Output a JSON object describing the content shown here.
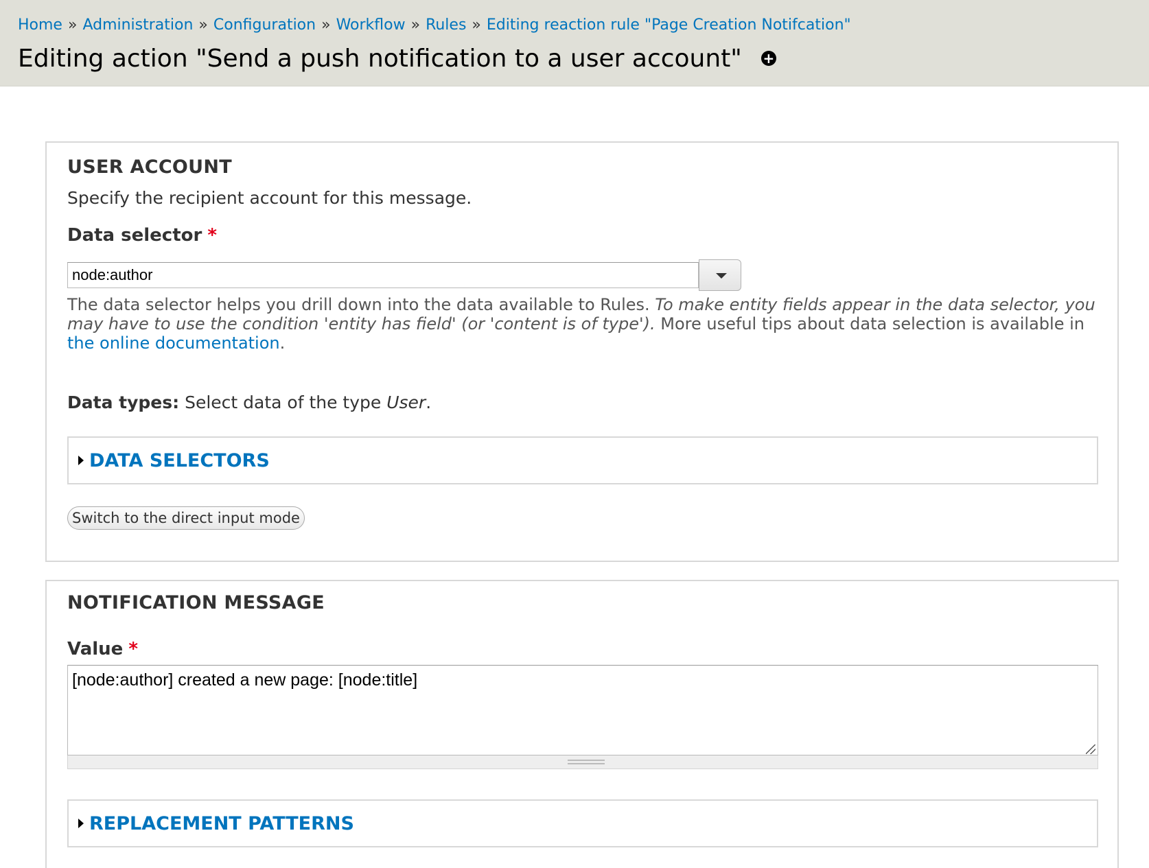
{
  "breadcrumb": [
    {
      "label": "Home"
    },
    {
      "label": "Administration"
    },
    {
      "label": "Configuration"
    },
    {
      "label": "Workflow"
    },
    {
      "label": "Rules"
    },
    {
      "label": "Editing reaction rule \"Page Creation Notifcation\""
    }
  ],
  "breadcrumb_separator": "»",
  "page_title": "Editing action \"Send a push notification to a user account\"",
  "shortcut_icon_glyph": "+",
  "user_account": {
    "legend": "User account",
    "description": "Specify the recipient account for this message.",
    "data_selector": {
      "label": "Data selector",
      "required_mark": "*",
      "value": "node:author"
    },
    "help": {
      "part1": "The data selector helps you drill down into the data available to Rules. ",
      "part2_italic": "To make entity fields appear in the data selector, you may have to use the condition 'entity has field' (or 'content is of type').",
      "part3": " More useful tips about data selection is available in ",
      "link": "the online documentation",
      "part4": "."
    },
    "data_types": {
      "label": "Data types:",
      "text": " Select data of the type ",
      "type": "User",
      "end": "."
    },
    "data_selectors_collapsible": "Data selectors",
    "switch_button": "Switch to the direct input mode"
  },
  "notification_message": {
    "legend": "Notification message",
    "value_label": "Value",
    "required_mark": "*",
    "value": "[node:author] created a new page: [node:title]",
    "replacement_patterns_collapsible": "Replacement patterns"
  }
}
